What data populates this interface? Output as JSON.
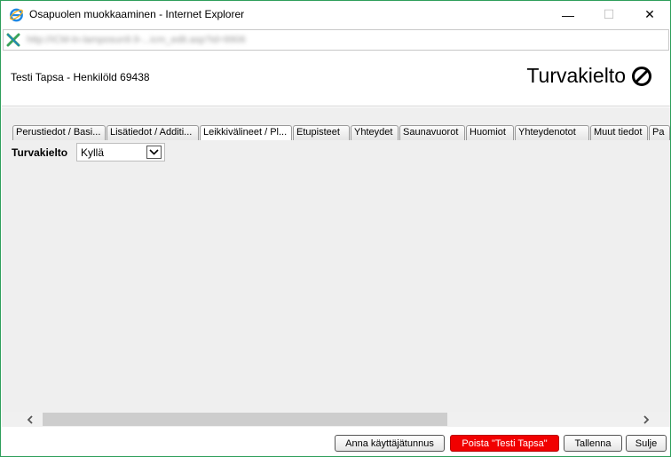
{
  "window": {
    "title": "Osapuolen muokkaaminen - Internet Explorer",
    "url": "http://ICM-ln-lamposun9.9-...icm_edit.asp?id=9906",
    "controls": {
      "minimize": "—",
      "maximize": "☐",
      "close": "✕"
    }
  },
  "header": {
    "person": "Testi Tapsa - Henkilöld 69438",
    "banner": "Turvakielto",
    "banner_icon": "no-entry-icon"
  },
  "tabs": [
    {
      "label": "Perustiedot / Basi...",
      "width": 105
    },
    {
      "label": "Lisätiedot / Additi...",
      "width": 104
    },
    {
      "label": "Leikkivälineet / Pl...",
      "width": 104
    },
    {
      "label": "Etupisteet",
      "width": 64
    },
    {
      "label": "Yhteydet",
      "width": 54
    },
    {
      "label": "Saunavuorot",
      "width": 74
    },
    {
      "label": "Huomiot",
      "width": 54
    },
    {
      "label": "Yhteydenotot",
      "width": 84
    },
    {
      "label": "Muut tiedot",
      "width": 65
    },
    {
      "label": "Pa",
      "width": 24
    }
  ],
  "form": {
    "label": "Turvakielto",
    "value": "Kyllä"
  },
  "footer": {
    "give_user": "Anna käyttäjätunnus",
    "delete": "Poista \"Testi Tapsa\"",
    "save": "Tallenna",
    "close": "Sulje"
  },
  "colors": {
    "window_border": "#2e9e5b",
    "delete_button": "#f10000",
    "content_bg": "#efefef"
  }
}
